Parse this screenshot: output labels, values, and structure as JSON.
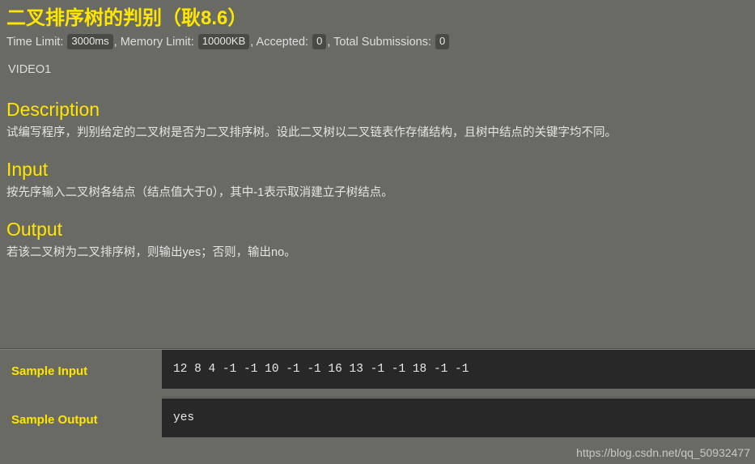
{
  "problem": {
    "title": "二叉排序树的判别（耿8.6）",
    "video_label": "VIDEO1"
  },
  "meta": {
    "time_limit_label": "Time Limit:",
    "time_limit_value": "3000ms",
    "comma1": ",",
    "memory_limit_label": "Memory Limit:",
    "memory_limit_value": "10000KB",
    "comma2": ",",
    "accepted_label": "Accepted:",
    "accepted_value": "0",
    "comma3": ",",
    "submissions_label": "Total Submissions:",
    "submissions_value": "0"
  },
  "sections": {
    "description": {
      "heading": "Description",
      "body": "试编写程序，判别给定的二叉树是否为二叉排序树。设此二叉树以二叉链表作存储结构，且树中结点的关键字均不同。"
    },
    "input": {
      "heading": "Input",
      "body": "按先序输入二叉树各结点（结点值大于0），其中-1表示取消建立子树结点。"
    },
    "output": {
      "heading": "Output",
      "body": "若该二叉树为二叉排序树，则输出yes；否则，输出no。"
    }
  },
  "samples": {
    "input": {
      "label": "Sample Input",
      "content": "12 8 4 -1 -1 10 -1 -1 16 13 -1 -1 18 -1 -1"
    },
    "output": {
      "label": "Sample Output",
      "content": "yes"
    }
  },
  "watermark": {
    "text": "https://blog.csdn.net/qq_50932477"
  },
  "colors": {
    "page_background": "#6a6a64",
    "heading_yellow": "#ffe600",
    "body_text": "#e4e4e4",
    "code_background": "#282828",
    "badge_background": "#4a4a45"
  }
}
